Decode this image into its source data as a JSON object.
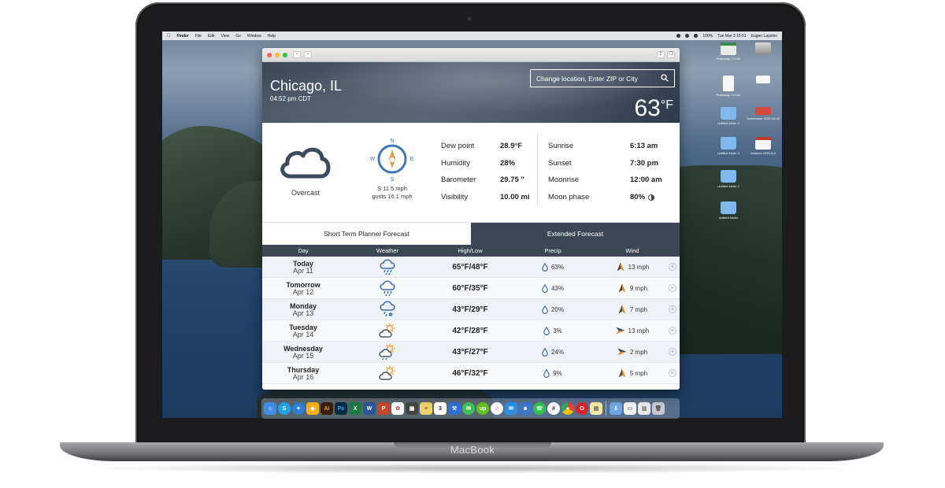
{
  "device": {
    "brand": "MacBook"
  },
  "menubar": {
    "app": "Finder",
    "items": [
      "File",
      "Edit",
      "View",
      "Go",
      "Window",
      "Help"
    ],
    "datetime": "Tue Mar 3  15:51",
    "user": "Eugen Lapshin",
    "battery": "100%"
  },
  "desktop": {
    "icons": [
      {
        "label": "Pulseway 7.0.dm",
        "kind": "doc"
      },
      {
        "label": "",
        "kind": "drive"
      },
      {
        "label": "Pulseway 7.0.dm",
        "kind": "doc"
      },
      {
        "label": "",
        "kind": "doc"
      },
      {
        "label": "untitled folder 4",
        "kind": "folder"
      },
      {
        "label": "Screenshot 2020-03-03",
        "kind": "doc"
      },
      {
        "label": "untitled folder 3",
        "kind": "folder"
      },
      {
        "label": "features 2020-3-9",
        "kind": "doc"
      },
      {
        "label": "untitled folder 2",
        "kind": "folder"
      },
      {
        "label": "untitled folder",
        "kind": "folder"
      }
    ]
  },
  "window": {
    "nav_back": "‹",
    "nav_forward": "›"
  },
  "header": {
    "city": "Chicago, IL",
    "local_time": "04:52 pm CDT",
    "search_placeholder": "Change location, Enter ZIP or City",
    "temperature": "63",
    "temperature_unit": "°F"
  },
  "current": {
    "condition": "Overcast",
    "condition_icon": "cloud-icon",
    "compass": {
      "n": "N",
      "e": "E",
      "s": "S",
      "w": "W"
    },
    "wind_line1": "S 11.5 mph",
    "wind_line2": "gusts 16.1 mph",
    "metrics_left": [
      {
        "label": "Dew point",
        "value": "28.9°F"
      },
      {
        "label": "Humidity",
        "value": "28%"
      },
      {
        "label": "Barometer",
        "value": "29.75 \""
      },
      {
        "label": "Visibility",
        "value": "10.00 mi"
      }
    ],
    "metrics_right": [
      {
        "label": "Sunrise",
        "value": "6:13 am"
      },
      {
        "label": "Sunset",
        "value": "7:30 pm"
      },
      {
        "label": "Moonrise",
        "value": "12:00 am"
      },
      {
        "label": "Moon phase",
        "value": "80%"
      }
    ]
  },
  "tabs": [
    {
      "label": "Short Term Planner Forecast",
      "active": true
    },
    {
      "label": "Extended Forecast",
      "active": false
    }
  ],
  "forecast": {
    "headers": [
      "Day",
      "Weather",
      "High/Low",
      "Precip",
      "Wind"
    ],
    "rows": [
      {
        "day": "Today",
        "date": "Apr 11",
        "icon": "rain-cloud-icon",
        "hilo": "65°F/48°F",
        "precip": "63%",
        "wind": "13 mph",
        "wind_dir": "north"
      },
      {
        "day": "Tomorrow",
        "date": "Apr 12",
        "icon": "rain-cloud-icon",
        "hilo": "60°F/35°F",
        "precip": "43%",
        "wind": "9 mph",
        "wind_dir": "north"
      },
      {
        "day": "Monday",
        "date": "Apr 13",
        "icon": "rain-snow-cloud-icon",
        "hilo": "43°F/29°F",
        "precip": "20%",
        "wind": "7 mph",
        "wind_dir": "north"
      },
      {
        "day": "Tuesday",
        "date": "Apr 14",
        "icon": "partly-sunny-icon",
        "hilo": "42°F/28°F",
        "precip": "3%",
        "wind": "13 mph",
        "wind_dir": "east"
      },
      {
        "day": "Wednesday",
        "date": "Apr 15",
        "icon": "partly-sunny-rain-icon",
        "hilo": "43°F/27°F",
        "precip": "24%",
        "wind": "2 mph",
        "wind_dir": "east"
      },
      {
        "day": "Thursday",
        "date": "Apr 16",
        "icon": "partly-sunny-icon",
        "hilo": "46°F/32°F",
        "precip": "9%",
        "wind": "5 mph",
        "wind_dir": "north"
      }
    ]
  },
  "dock": {
    "apps": [
      "finder-icon",
      "skype-icon",
      "safari-icon",
      "sketch-icon",
      "illustrator-icon",
      "photoshop-icon",
      "excel-icon",
      "word-icon",
      "powerpoint-icon",
      "photos-icon",
      "app-icon",
      "notes-icon",
      "calendar-icon",
      "xcode-icon",
      "messages-icon",
      "upwork-icon",
      "itunes-icon",
      "mail-icon",
      "contacts-icon",
      "whatsapp-icon",
      "slack-icon",
      "chrome-icon",
      "opera-icon",
      "stickies-icon",
      "downloads-icon",
      "documents-icon",
      "preview-icon",
      "trash-icon"
    ]
  },
  "colors": {
    "accent": "#3c4656",
    "compass_needle": "#e89a3a",
    "compass_ring": "#3e77b6",
    "icon_blue": "#3e6fa8",
    "wind_arrow": "#e08a2e"
  }
}
